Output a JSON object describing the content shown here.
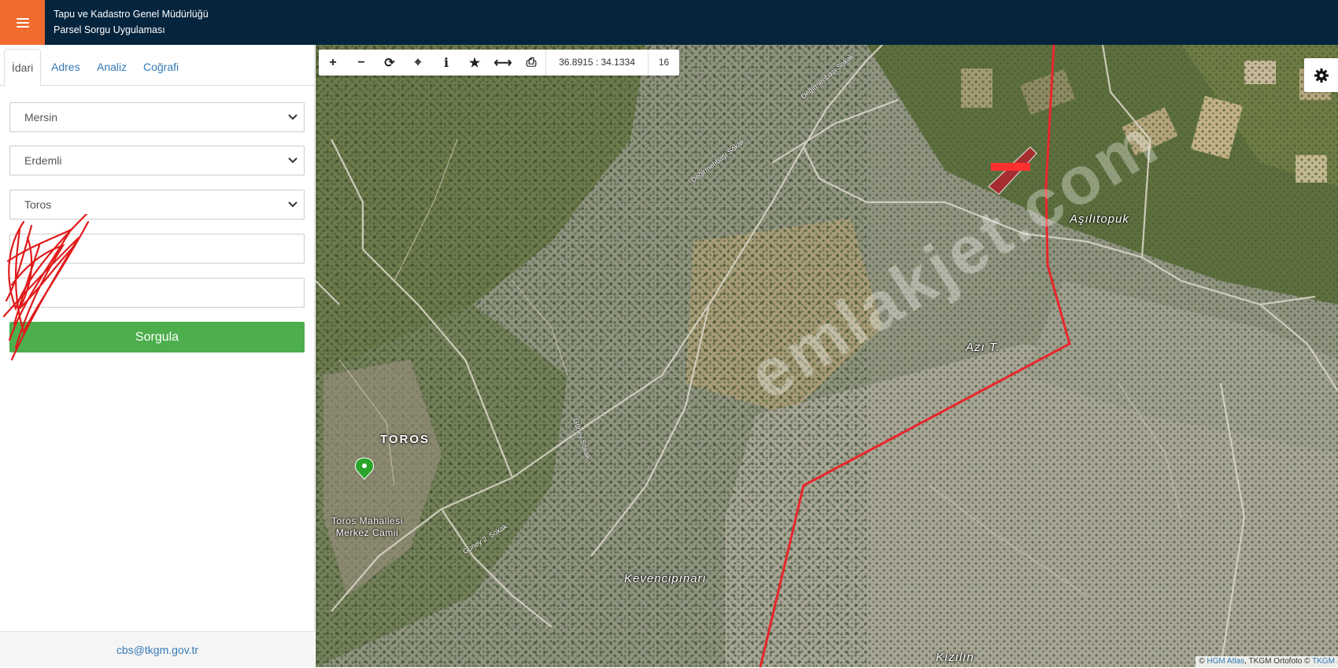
{
  "header": {
    "title_line1": "Tapu ve Kadastro Genel Müdürlüğü",
    "title_line2": "Parsel Sorgu Uygulaması"
  },
  "tabs": [
    {
      "label": "İdari",
      "active": true
    },
    {
      "label": "Adres",
      "active": false
    },
    {
      "label": "Analiz",
      "active": false
    },
    {
      "label": "Coğrafi",
      "active": false
    }
  ],
  "form": {
    "il": "Mersin",
    "ilce": "Erdemli",
    "mahalle": "Toros",
    "ada": "",
    "parsel": "",
    "submit_label": "Sorgula"
  },
  "footer": {
    "email": "cbs@tkgm.gov.tr"
  },
  "toolbar": {
    "tools": [
      {
        "name": "zoom-in-icon",
        "glyph": "+"
      },
      {
        "name": "zoom-out-icon",
        "glyph": "−"
      },
      {
        "name": "refresh-icon",
        "glyph": "⟳"
      },
      {
        "name": "locate-icon",
        "glyph": "⌖"
      },
      {
        "name": "info-icon",
        "glyph": "i"
      },
      {
        "name": "star-icon",
        "glyph": "★"
      },
      {
        "name": "measure-icon",
        "glyph": "⟷"
      },
      {
        "name": "print-icon",
        "glyph": "⎙"
      }
    ],
    "coordinates": "36.8915 : 34.1334",
    "zoom_level": "16"
  },
  "map": {
    "labels": {
      "asilitopuk": "Aşılıtopuk",
      "azi": "Azı T.",
      "kevencipinar": "Kevencipınarı",
      "kizilin": "Kızılın",
      "toros": "TOROS",
      "poi_line1": "Toros Mahallesi",
      "poi_line2": "Merkez Camii"
    },
    "roads": {
      "degirmenbasi": "Değirmenbaşı Sokak",
      "guney": "Güney 2. Sokak",
      "guney_sokak": "Güney Sokak"
    },
    "watermark": "emlakjet.com",
    "boundary_color": "#e8262a",
    "parcel_color": "#b3232f"
  },
  "attribution": {
    "hgm": "HGM Atlas",
    "middle": ", TKGM Ortofoto ©",
    "tkgm": "TKGM",
    "prefix": "©"
  }
}
